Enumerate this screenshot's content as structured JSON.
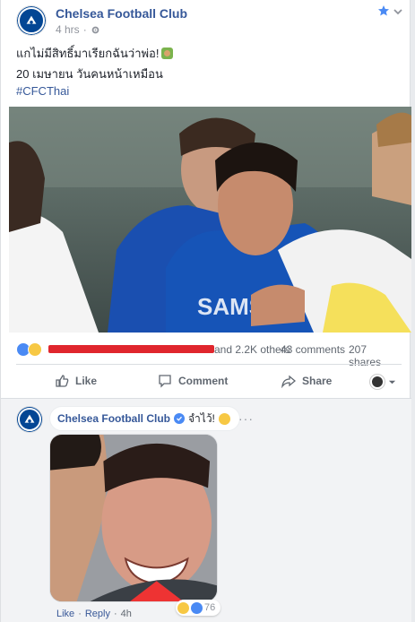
{
  "post": {
    "page_name": "Chelsea Football Club",
    "time": "4 hrs",
    "separator": "·",
    "line1": "แกไม่มีสิทธิ์มาเรียกฉันว่าพ่อ!",
    "line2": "20 เมษายน วันคนหน้าเหมือน",
    "hashtag": "#CFCThai"
  },
  "icons": {
    "privacy": "gear-icon",
    "star": "star-icon",
    "menu": "chevron-down-icon"
  },
  "reactions": {
    "others": "and 2.2K others",
    "comments": "43 comments",
    "shares": "207 shares"
  },
  "actions": {
    "like": "Like",
    "comment": "Comment",
    "share": "Share"
  },
  "comment": {
    "author": "Chelsea Football Club",
    "text": "จำไว้!",
    "dots": "···",
    "like": "Like",
    "reply": "Reply",
    "time": "4h",
    "sep": "·",
    "reaction_count": "76"
  },
  "colors": {
    "brand_blue": "#365899",
    "chelsea_blue": "#034694",
    "redaction": "#e0262d"
  }
}
